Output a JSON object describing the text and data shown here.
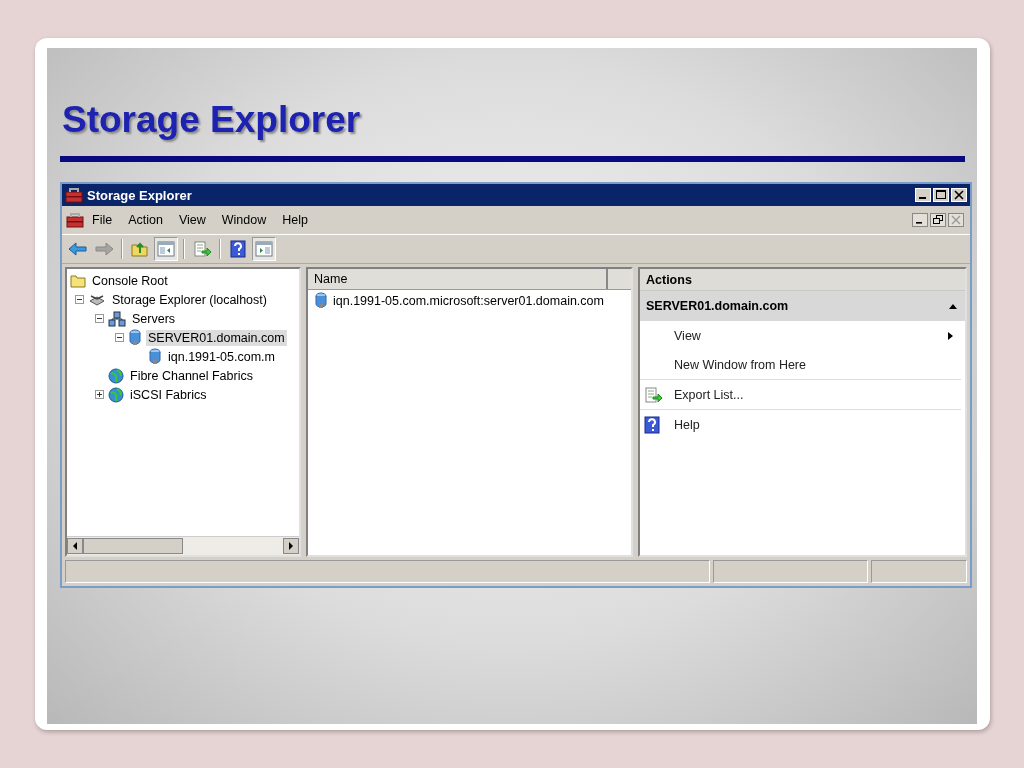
{
  "slide": {
    "title": "Storage Explorer"
  },
  "window": {
    "title": "Storage Explorer"
  },
  "menu": [
    "File",
    "Action",
    "View",
    "Window",
    "Help"
  ],
  "toolbar": [
    {
      "kind": "back",
      "disabled": false,
      "pressed": false
    },
    {
      "kind": "forward",
      "disabled": true,
      "pressed": false
    },
    {
      "kind": "separator"
    },
    {
      "kind": "up",
      "disabled": false,
      "pressed": false
    },
    {
      "kind": "tree",
      "disabled": false,
      "pressed": true
    },
    {
      "kind": "separator"
    },
    {
      "kind": "export",
      "disabled": false,
      "pressed": false
    },
    {
      "kind": "separator"
    },
    {
      "kind": "help",
      "disabled": false,
      "pressed": false
    },
    {
      "kind": "actionpane",
      "disabled": false,
      "pressed": true
    }
  ],
  "tree": [
    {
      "label": "Console Root",
      "kind": "folder",
      "selected": false,
      "children": [
        {
          "label": "Storage Explorer (localhost)",
          "kind": "storage",
          "expanded": true,
          "selected": false,
          "children": [
            {
              "label": "Servers",
              "kind": "servers",
              "expanded": true,
              "selected": false,
              "children": [
                {
                  "label": "SERVER01.domain.com",
                  "kind": "server",
                  "expanded": true,
                  "selected": true,
                  "children": [
                    {
                      "label": "iqn.1991-05.com.m",
                      "kind": "server",
                      "selected": false
                    }
                  ]
                }
              ]
            },
            {
              "label": "Fibre Channel Fabrics",
              "kind": "fabric",
              "selected": false
            },
            {
              "label": "iSCSI Fabrics",
              "kind": "fabric",
              "expanded": false,
              "selected": false
            }
          ]
        }
      ]
    }
  ],
  "list": {
    "columns": [
      "Name"
    ],
    "rows": [
      {
        "name": "iqn.1991-05.com.microsoft:server01.domain.com",
        "kind": "server"
      }
    ]
  },
  "actions": {
    "title": "Actions",
    "section": {
      "title": "SERVER01.domain.com",
      "expanded": true
    },
    "items": [
      {
        "label": "View",
        "kind": "plain",
        "submenu": true,
        "separator_after": false
      },
      {
        "label": "New Window from Here",
        "kind": "plain",
        "submenu": false,
        "separator_after": true
      },
      {
        "label": "Export List...",
        "kind": "export",
        "submenu": false,
        "separator_after": true
      },
      {
        "label": "Help",
        "kind": "help",
        "submenu": false,
        "separator_after": false
      }
    ]
  }
}
